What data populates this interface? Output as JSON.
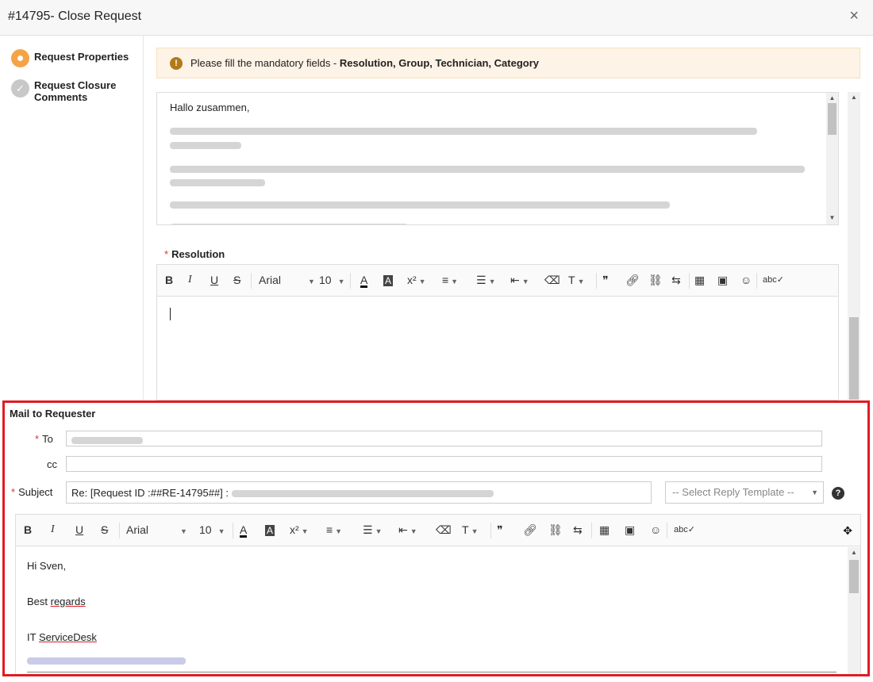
{
  "dialog": {
    "title": "#14795- Close Request",
    "close_glyph": "×"
  },
  "steps": [
    {
      "label": "Request Properties",
      "state": "active"
    },
    {
      "label": "Request Closure Comments",
      "state": "done"
    }
  ],
  "warning": {
    "prefix": "Please fill the mandatory fields - ",
    "fields": "Resolution, Group, Technician, Category"
  },
  "comments": {
    "greeting": "Hallo zusammen,"
  },
  "resolution": {
    "label": "Resolution",
    "font": "Arial",
    "size": "10"
  },
  "mail": {
    "title": "Mail to Requester",
    "to_label": "To",
    "cc_label": "cc",
    "subject_label": "Subject",
    "subject_value": "Re: [Request ID :##RE-14795##] :",
    "template_placeholder": "-- Select Reply Template --",
    "font": "Arial",
    "size": "10",
    "body": {
      "greeting": "Hi Sven,",
      "closing_1": "Best ",
      "closing_2": "regards",
      "sign_1": "IT ",
      "sign_2": "ServiceDesk"
    }
  },
  "icons": {
    "warning": "!",
    "help": "?",
    "check": "✓",
    "expand": "✥"
  },
  "colors": {
    "accent": "#f5a347",
    "highlight_border": "#e11b22",
    "warning_bg": "#fdf3e6"
  }
}
